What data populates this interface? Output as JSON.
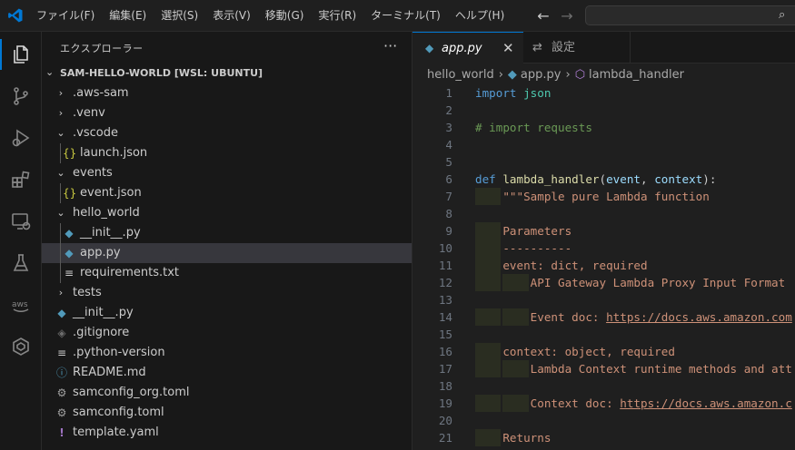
{
  "menu": {
    "items": [
      "ファイル(F)",
      "編集(E)",
      "選択(S)",
      "表示(V)",
      "移動(G)",
      "実行(R)",
      "ターミナル(T)",
      "ヘルプ(H)"
    ]
  },
  "sidebar": {
    "title": "エクスプローラー",
    "folder_name": "SAM-HELLO-WORLD [WSL: UBUNTU]",
    "tree": [
      {
        "label": ".aws-sam",
        "type": "folder",
        "open": false
      },
      {
        "label": ".venv",
        "type": "folder",
        "open": false
      },
      {
        "label": ".vscode",
        "type": "folder",
        "open": true
      },
      {
        "label": "launch.json",
        "type": "json"
      },
      {
        "label": "events",
        "type": "folder",
        "open": true
      },
      {
        "label": "event.json",
        "type": "json"
      },
      {
        "label": "hello_world",
        "type": "folder",
        "open": true
      },
      {
        "label": "__init__.py",
        "type": "python"
      },
      {
        "label": "app.py",
        "type": "python",
        "selected": true
      },
      {
        "label": "requirements.txt",
        "type": "text"
      },
      {
        "label": "tests",
        "type": "folder",
        "open": false
      },
      {
        "label": "__init__.py",
        "type": "python"
      },
      {
        "label": ".gitignore",
        "type": "git"
      },
      {
        "label": ".python-version",
        "type": "text"
      },
      {
        "label": "README.md",
        "type": "info"
      },
      {
        "label": "samconfig_org.toml",
        "type": "gear"
      },
      {
        "label": "samconfig.toml",
        "type": "gear"
      },
      {
        "label": "template.yaml",
        "type": "yaml"
      }
    ]
  },
  "editor": {
    "tabs": [
      {
        "label": "app.py",
        "active": true
      },
      {
        "label": "設定",
        "active": false
      }
    ],
    "breadcrumb": [
      "hello_world",
      "app.py",
      "lambda_handler"
    ],
    "lines": [
      {
        "n": "1",
        "text": "import json"
      },
      {
        "n": "2",
        "text": ""
      },
      {
        "n": "3",
        "text": "# import requests"
      },
      {
        "n": "4",
        "text": ""
      },
      {
        "n": "5",
        "text": ""
      },
      {
        "n": "6",
        "text": "def lambda_handler(event, context):"
      },
      {
        "n": "7",
        "text": "    \"\"\"Sample pure Lambda function"
      },
      {
        "n": "8",
        "text": ""
      },
      {
        "n": "9",
        "text": "    Parameters"
      },
      {
        "n": "10",
        "text": "    ----------"
      },
      {
        "n": "11",
        "text": "    event: dict, required"
      },
      {
        "n": "12",
        "text": "        API Gateway Lambda Proxy Input Format"
      },
      {
        "n": "13",
        "text": ""
      },
      {
        "n": "14",
        "text": "        Event doc: https://docs.aws.amazon.com"
      },
      {
        "n": "15",
        "text": ""
      },
      {
        "n": "16",
        "text": "    context: object, required"
      },
      {
        "n": "17",
        "text": "        Lambda Context runtime methods and att"
      },
      {
        "n": "18",
        "text": ""
      },
      {
        "n": "19",
        "text": "        Context doc: https://docs.aws.amazon.c"
      },
      {
        "n": "20",
        "text": ""
      },
      {
        "n": "21",
        "text": "    Returns"
      }
    ]
  },
  "colors": {
    "accent": "#0078d4",
    "selection": "#37373d",
    "keyword": "#569cd6",
    "comment": "#6a9955",
    "string": "#ce9178",
    "function": "#dcdcaa",
    "parameter": "#9cdcfe"
  }
}
